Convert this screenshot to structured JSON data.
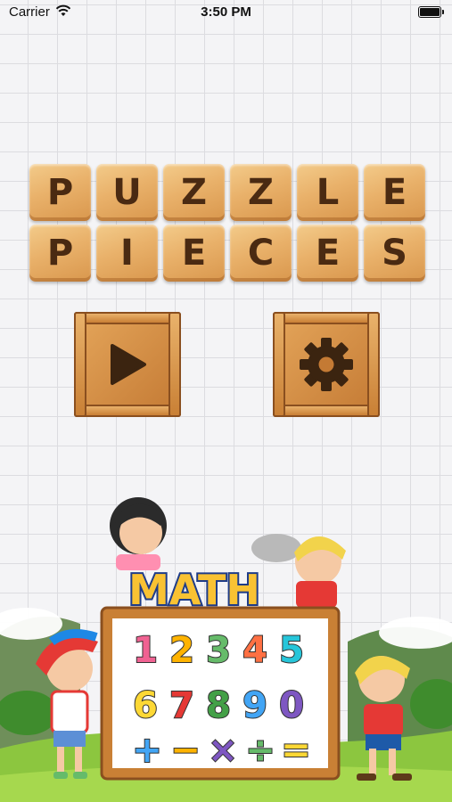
{
  "status_bar": {
    "carrier": "Carrier",
    "time": "3:50 PM"
  },
  "title": {
    "line1": [
      "P",
      "U",
      "Z",
      "Z",
      "L",
      "E"
    ],
    "line2": [
      "P",
      "I",
      "E",
      "C",
      "E",
      "S"
    ]
  },
  "buttons": {
    "play_icon": "play-icon",
    "settings_icon": "gear-icon"
  },
  "illustration": {
    "heading": "MATH",
    "digits_row1": [
      "1",
      "2",
      "3",
      "4",
      "5"
    ],
    "digits_row2": [
      "6",
      "7",
      "8",
      "9",
      "0"
    ],
    "operators": [
      "+",
      "−",
      "×",
      "÷",
      "="
    ]
  },
  "colors": {
    "tile_wood": "#e9b16a",
    "letter": "#4a2a12",
    "crate": "#c47a34"
  }
}
